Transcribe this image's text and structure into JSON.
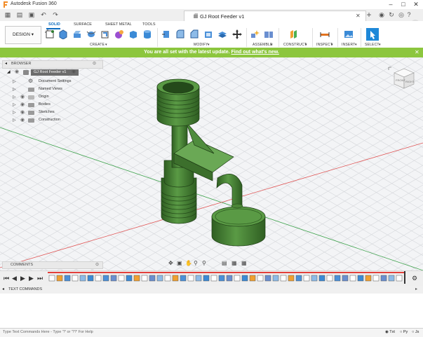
{
  "window": {
    "app_title": "Autodesk Fusion 360",
    "doc_title": "GJ Root Feeder v1",
    "user_initials": "JE"
  },
  "quick_access": {
    "icons": [
      "app-grid-icon",
      "file-menu-icon",
      "save-icon",
      "undo-icon",
      "redo-icon"
    ]
  },
  "workspace": {
    "label": "DESIGN"
  },
  "ribbon": {
    "tabs": [
      "SOLID",
      "SURFACE",
      "SHEET METAL",
      "TOOLS"
    ],
    "active_tab": "SOLID",
    "groups": [
      "CREATE",
      "MODIFY",
      "ASSEMBLE",
      "CONSTRUCT",
      "INSPECT",
      "INSERT",
      "SELECT"
    ]
  },
  "banner": {
    "message": "You are all set with the latest update.",
    "link": "Find out what's new."
  },
  "browser": {
    "title": "BROWSER",
    "root": "GJ Root Feeder v1",
    "items": [
      "Document Settings",
      "Named Views",
      "Origin",
      "Bodies",
      "Sketches",
      "Construction"
    ]
  },
  "viewcube": {
    "front": "FRONT",
    "right": "RIGHT"
  },
  "comments": {
    "title": "COMMENTS"
  },
  "text_commands": {
    "title": "TEXT COMMANDS",
    "placeholder": "Type Text Commands Here - Type '?' or '??' For Help",
    "modes": [
      "Txt",
      "Py",
      "Js"
    ],
    "selected_mode": "Txt"
  },
  "colors": {
    "banner": "#8cc63e",
    "accent": "#0b6bbf",
    "model": "#4e8a3a",
    "timeline_red": "#e2403a"
  }
}
